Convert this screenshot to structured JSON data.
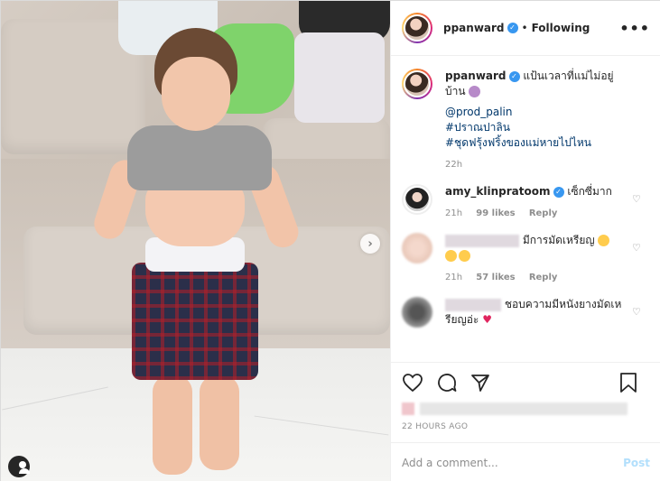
{
  "post": {
    "username": "ppanward",
    "verified": true,
    "follow_status": "Following",
    "separator": "•",
    "more_icon": "more-horizontal-icon"
  },
  "caption": {
    "username": "ppanward",
    "text": "แป้นเวลาที่แม่ไม่อยู่บ้าน",
    "mention": "@prod_palin",
    "hashtag1": "#ปราณปาลิน",
    "hashtag2": "#ชุดฟรุ้งฟริ้งของแม่หายไปไหน",
    "time": "22h"
  },
  "comments": [
    {
      "username": "amy_klinpratoom",
      "verified": true,
      "text": "เซ็กซี่มาก",
      "time": "21h",
      "likes": "99 likes",
      "reply": "Reply"
    },
    {
      "username": "",
      "text": "มีการมัดเหรียญ",
      "time": "21h",
      "likes": "57 likes",
      "reply": "Reply"
    },
    {
      "username": "",
      "text": "ชอบความมีหนังยางมัดเหรียญอ่ะ"
    }
  ],
  "actions": {
    "timestamp": "22 HOURS AGO"
  },
  "composer": {
    "placeholder": "Add a comment...",
    "post_label": "Post"
  },
  "colors": {
    "link": "#00376b",
    "verified": "#3897f0",
    "post_disabled": "#b2dffc"
  }
}
